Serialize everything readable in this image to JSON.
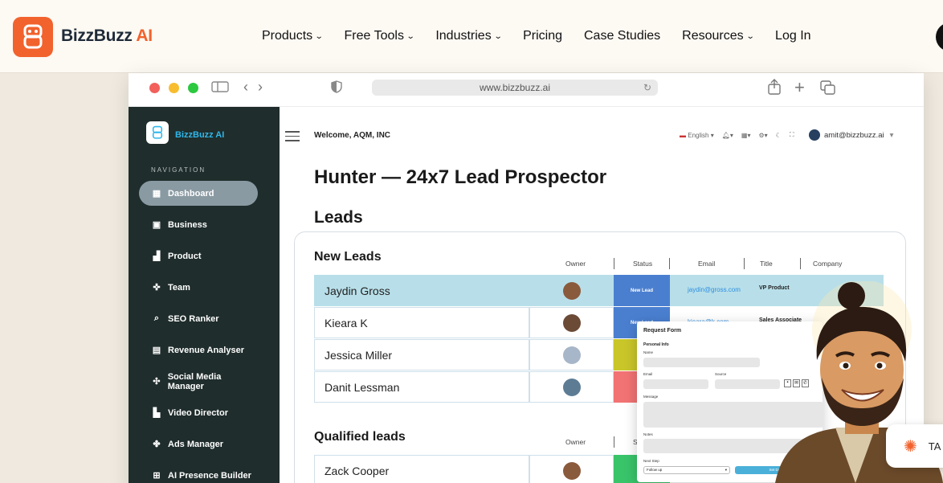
{
  "site": {
    "brand_part1": "BizzBuzz",
    "brand_part2": "AI",
    "nav": [
      {
        "label": "Products",
        "dropdown": true
      },
      {
        "label": "Free Tools",
        "dropdown": true
      },
      {
        "label": "Industries",
        "dropdown": true
      },
      {
        "label": "Pricing",
        "dropdown": false
      },
      {
        "label": "Case Studies",
        "dropdown": false
      },
      {
        "label": "Resources",
        "dropdown": true
      },
      {
        "label": "Log In",
        "dropdown": false
      }
    ],
    "accent": "#f2622d"
  },
  "browser": {
    "url": "www.bizzbuzz.ai"
  },
  "app": {
    "brand": "BizzBuzz AI",
    "nav_heading": "NAVIGATION",
    "nav_items": [
      {
        "label": "Dashboard",
        "icon": "grid-icon",
        "active": true
      },
      {
        "label": "Business",
        "icon": "briefcase-icon",
        "active": false
      },
      {
        "label": "Product",
        "icon": "bar-chart-icon",
        "active": false
      },
      {
        "label": "Team",
        "icon": "team-icon",
        "active": false
      },
      {
        "label": "SEO Ranker",
        "icon": "search-icon",
        "active": false
      },
      {
        "label": "Revenue Analyser",
        "icon": "calendar-icon",
        "active": false
      },
      {
        "label": "Social Media Manager",
        "icon": "share-icon",
        "active": false
      },
      {
        "label": "Video Director",
        "icon": "video-icon",
        "active": false
      },
      {
        "label": "Ads Manager",
        "icon": "ads-icon",
        "active": false
      },
      {
        "label": "AI Presence Builder",
        "icon": "plus-icon",
        "active": false
      }
    ],
    "welcome": "Welcome, AQM, INC",
    "language": "English",
    "user_email": "amit@bizzbuzz.ai",
    "page_title": "Hunter — 24x7 Lead Prospector",
    "section_title": "Leads",
    "new_leads": {
      "title": "New Leads",
      "columns": [
        "Owner",
        "Status",
        "Email",
        "Title",
        "Company"
      ],
      "rows": [
        {
          "name": "Jaydin Gross",
          "status": "New Lead",
          "status_color": "#4a7fd0",
          "email": "jaydin@gross.com",
          "title": "VP Product"
        },
        {
          "name": "Kieara K",
          "status": "New Lead",
          "status_color": "#4a7fd0",
          "email": "kieara@k.com",
          "title": "Sales Associate"
        },
        {
          "name": "Jessica Miller",
          "status": "Co",
          "status_color": "#c9c62a",
          "email": "",
          "title": ""
        },
        {
          "name": "Danit Lessman",
          "status": "Fo",
          "status_color": "#f27373",
          "email": "",
          "title": ""
        }
      ]
    },
    "qualified_leads": {
      "title": "Qualified leads",
      "columns": [
        "Owner",
        "St"
      ],
      "rows": [
        {
          "name": "Zack Cooper",
          "status": "Qu",
          "status_color": "#39c46a"
        }
      ]
    },
    "request_form": {
      "title": "Request Form",
      "section": "Personal Info",
      "labels": [
        "Name",
        "Email",
        "Source",
        "Message",
        "Notes",
        "Next Step"
      ],
      "next_step_value": "Follow up",
      "submit_label": "Set Dat"
    }
  },
  "chat_button": {
    "label": "TA"
  }
}
